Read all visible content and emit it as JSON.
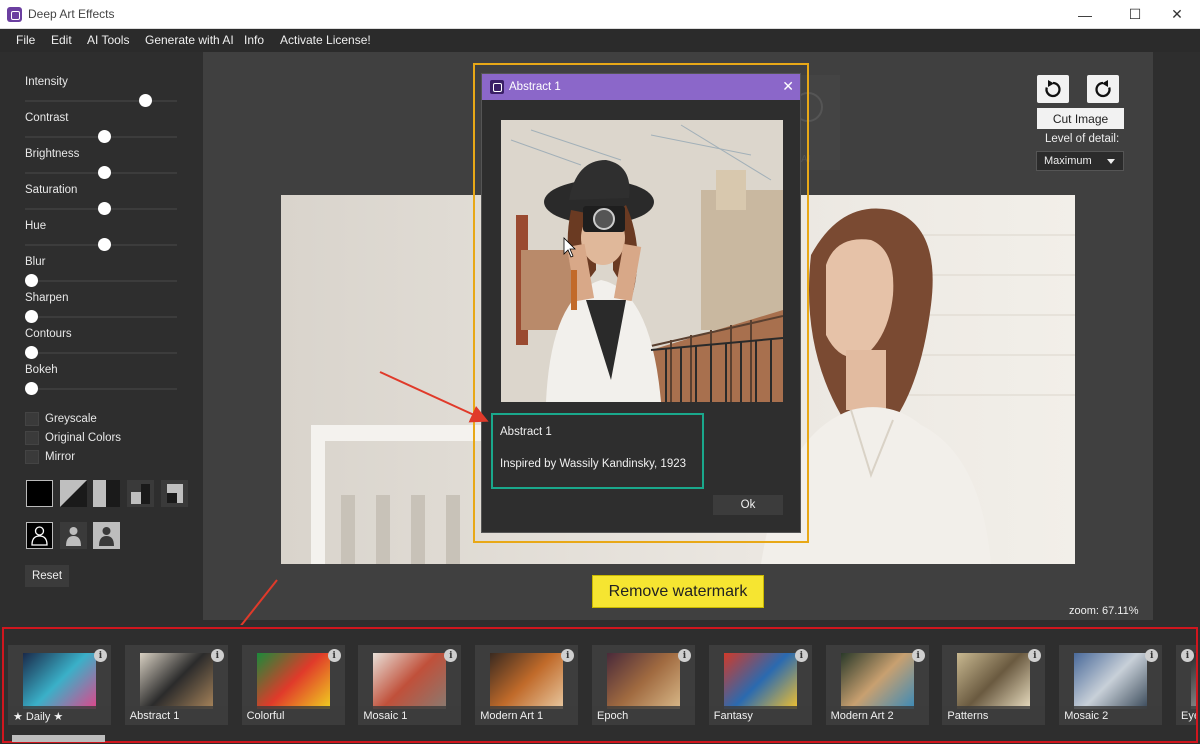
{
  "window": {
    "title": "Deep Art Effects",
    "minimize": "—",
    "maximize": "☐",
    "close": "✕"
  },
  "menu": [
    "File",
    "Edit",
    "AI Tools",
    "Generate with AI",
    "Info",
    "Activate License!"
  ],
  "sliders": [
    {
      "label": "Intensity",
      "value": 0.78
    },
    {
      "label": "Contrast",
      "value": 0.5
    },
    {
      "label": "Brightness",
      "value": 0.5
    },
    {
      "label": "Saturation",
      "value": 0.5
    },
    {
      "label": "Hue",
      "value": 0.5
    },
    {
      "label": "Blur",
      "value": 0.0
    },
    {
      "label": "Sharpen",
      "value": 0.0
    },
    {
      "label": "Contours",
      "value": 0.0
    },
    {
      "label": "Bokeh",
      "value": 0.0
    }
  ],
  "checkboxes": [
    {
      "label": "Greyscale",
      "checked": false
    },
    {
      "label": "Original Colors",
      "checked": false
    },
    {
      "label": "Mirror",
      "checked": false
    }
  ],
  "reset_label": "Reset",
  "toolbar": {
    "cut_image": "Cut Image",
    "level_of_detail_label": "Level of detail:",
    "level_of_detail_value": "Maximum"
  },
  "remove_watermark": "Remove watermark",
  "zoom": "zoom: 67.11%",
  "dialog": {
    "title": "Abstract 1",
    "name": "Abstract 1",
    "description": "Inspired by Wassily Kandinsky, 1923",
    "ok": "Ok"
  },
  "styles": [
    {
      "label": "★ Daily ★",
      "colors": [
        "#1a2a4a",
        "#3ab0c8",
        "#e0458a"
      ]
    },
    {
      "label": "Abstract 1",
      "colors": [
        "#d8d0c2",
        "#2b2b2b",
        "#a8845a"
      ]
    },
    {
      "label": "Colorful",
      "colors": [
        "#1a8a3a",
        "#e03a2a",
        "#f0d020"
      ]
    },
    {
      "label": "Mosaic 1",
      "colors": [
        "#e8e0d8",
        "#c0503a",
        "#8a7a70"
      ]
    },
    {
      "label": "Modern Art 1",
      "colors": [
        "#3a2a20",
        "#c06a2a",
        "#e8c8a0"
      ]
    },
    {
      "label": "Epoch",
      "colors": [
        "#4a2a3a",
        "#a06a40",
        "#d8b888"
      ]
    },
    {
      "label": "Fantasy",
      "colors": [
        "#d03a2a",
        "#2a6ab0",
        "#f0c030"
      ]
    },
    {
      "label": "Modern Art 2",
      "colors": [
        "#2a3a2a",
        "#c8a070",
        "#3a8ab8"
      ]
    },
    {
      "label": "Patterns",
      "colors": [
        "#c8b890",
        "#6a5a40",
        "#e8dcc0"
      ]
    },
    {
      "label": "Mosaic 2",
      "colors": [
        "#4a6a9a",
        "#c8d0d8",
        "#3a4a5a"
      ]
    },
    {
      "label": "Eye",
      "colors": [
        "#2a2a2a",
        "#8a8a8a",
        "#d8d8d8"
      ]
    }
  ],
  "info_icon_glyph": "i",
  "accent": {
    "dialog_title": "#8b67c9",
    "watermark_button": "#f6e531",
    "annotation_red": "#d0161e",
    "annotation_yellow": "#e8a817",
    "annotation_green": "#1aa88c"
  }
}
